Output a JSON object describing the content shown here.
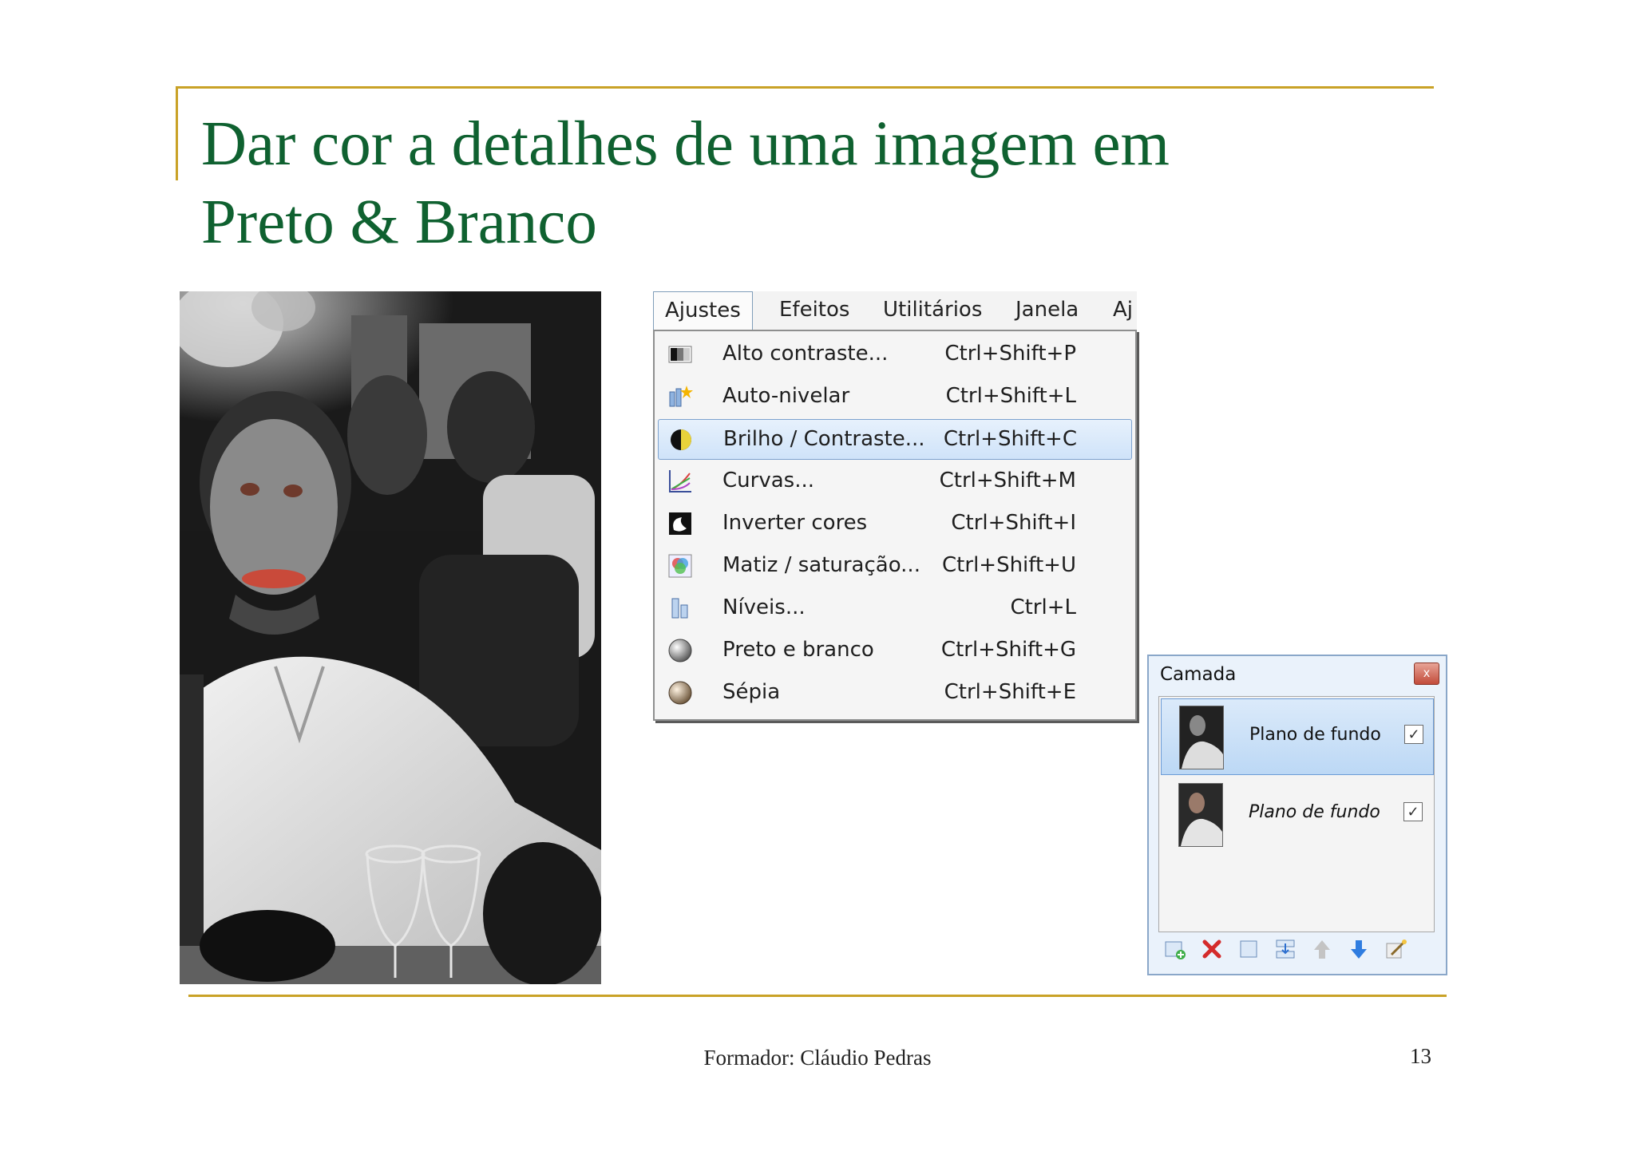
{
  "slide": {
    "title_line1": "Dar cor a detalhes de uma imagem em",
    "title_line2": "Preto & Branco",
    "footer": "Formador: Cláudio Pedras",
    "page_number": "13",
    "accent_color": "#c9a227",
    "title_color": "#0f6130"
  },
  "menubar": {
    "items": [
      "Ajustes",
      "Efeitos",
      "Utilitários",
      "Janela",
      "Aj"
    ],
    "active": "Ajustes"
  },
  "menu": {
    "items": [
      {
        "label": "Alto contraste...",
        "shortcut": "Ctrl+Shift+P",
        "icon": "auto-contrast-icon"
      },
      {
        "label": "Auto-nivelar",
        "shortcut": "Ctrl+Shift+L",
        "icon": "auto-level-icon"
      },
      {
        "label": "Brilho / Contraste...",
        "shortcut": "Ctrl+Shift+C",
        "icon": "brightness-contrast-icon",
        "highlighted": true
      },
      {
        "label": "Curvas...",
        "shortcut": "Ctrl+Shift+M",
        "icon": "curves-icon"
      },
      {
        "label": "Inverter cores",
        "shortcut": "Ctrl+Shift+I",
        "icon": "invert-colors-icon"
      },
      {
        "label": "Matiz / saturação...",
        "shortcut": "Ctrl+Shift+U",
        "icon": "hue-saturation-icon"
      },
      {
        "label": "Níveis...",
        "shortcut": "Ctrl+L",
        "icon": "levels-icon"
      },
      {
        "label": "Preto e branco",
        "shortcut": "Ctrl+Shift+G",
        "icon": "black-and-white-icon"
      },
      {
        "label": "Sépia",
        "shortcut": "Ctrl+Shift+E",
        "icon": "sepia-icon"
      }
    ]
  },
  "layers_panel": {
    "title": "Camada",
    "close_glyph": "x",
    "layers": [
      {
        "name": "Plano de fundo",
        "checked": true,
        "selected": true,
        "italic": false
      },
      {
        "name": "Plano de fundo",
        "checked": true,
        "selected": false,
        "italic": true
      }
    ],
    "check_glyph": "✓",
    "toolbar_icons": [
      "add-layer-icon",
      "delete-layer-icon",
      "duplicate-layer-icon",
      "merge-layer-down-icon",
      "move-layer-up-icon",
      "move-layer-down-icon",
      "layer-properties-icon"
    ]
  }
}
